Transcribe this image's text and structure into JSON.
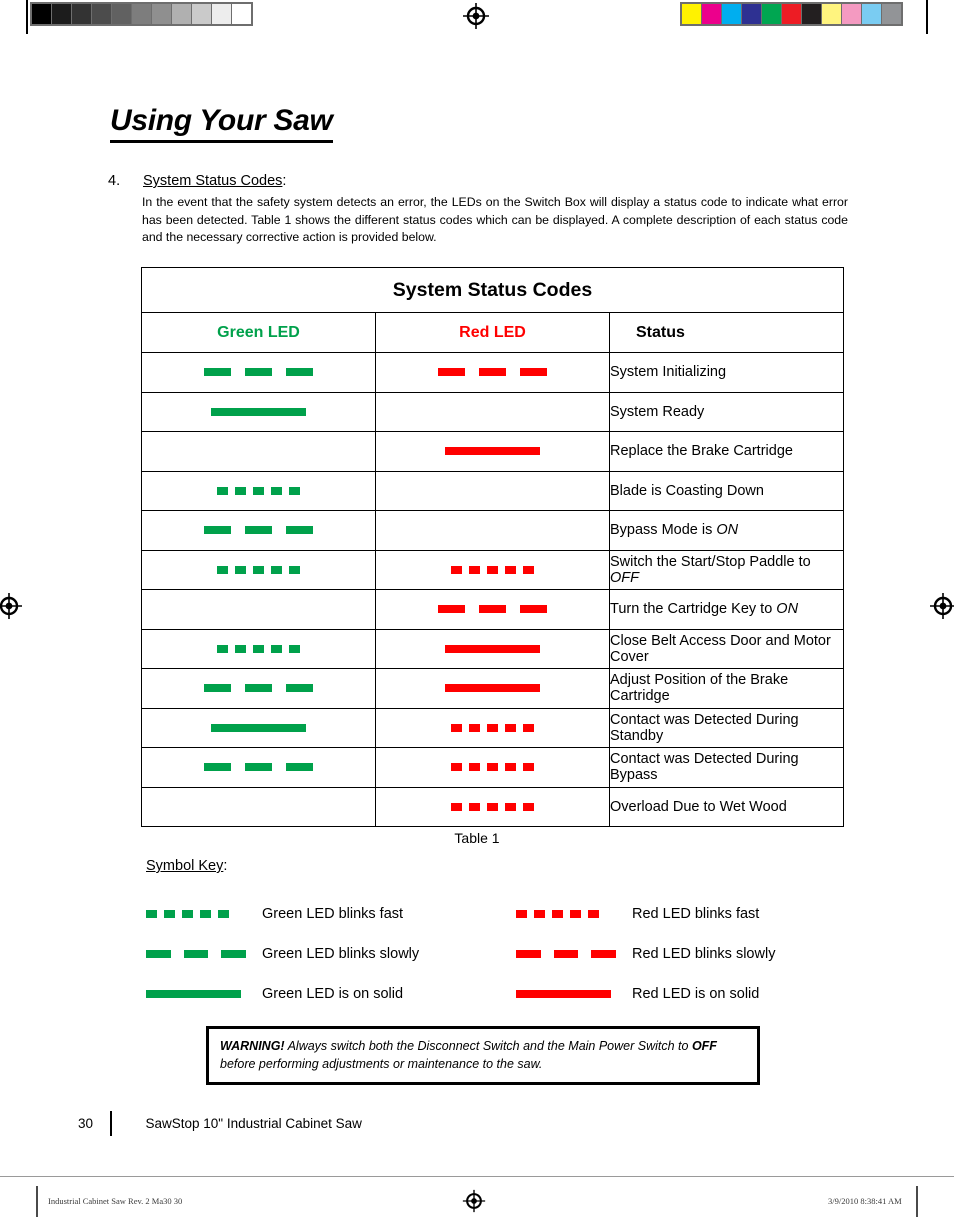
{
  "print_marks": {
    "grayscale_swatches": [
      "#000000",
      "#1c1c1c",
      "#333333",
      "#4c4c4c",
      "#616161",
      "#7d7d7d",
      "#8f8f8f",
      "#b0b0b0",
      "#cacaca",
      "#ededed",
      "#ffffff"
    ],
    "color_swatches": [
      "#fff200",
      "#ec008c",
      "#00aeef",
      "#2e3192",
      "#00a651",
      "#ed1c24",
      "#231f20",
      "#fff47f",
      "#f49ac1",
      "#7accf2",
      "#929497"
    ],
    "registration_icon": "registration-crosshair-icon"
  },
  "page": {
    "title": "Using Your Saw",
    "item": {
      "number": "4.",
      "heading": "System Status Codes",
      "heading_suffix": ":",
      "paragraph": "In the event that the safety system detects an error, the LEDs on the Switch Box will display a status code to indicate what error has been detected. Table 1 shows the different status codes which can be displayed. A complete description of each status code and the necessary corrective action is provided below."
    }
  },
  "table": {
    "title": "System Status Codes",
    "caption": "Table 1",
    "columns": [
      "Green LED",
      "Red LED",
      "Status"
    ],
    "column_colors": {
      "green": "#00a14b",
      "red": "#ff0000"
    },
    "rows": [
      {
        "green": "slow",
        "red": "slow",
        "status": "System Initializing",
        "status_italic": ""
      },
      {
        "green": "solid",
        "red": "off",
        "status": "System Ready",
        "status_italic": ""
      },
      {
        "green": "off",
        "red": "solid",
        "status": "Replace the Brake Cartridge",
        "status_italic": ""
      },
      {
        "green": "fast",
        "red": "off",
        "status": "Blade is Coasting Down",
        "status_italic": ""
      },
      {
        "green": "slow",
        "red": "off",
        "status": "Bypass Mode is ",
        "status_italic": "ON"
      },
      {
        "green": "fast",
        "red": "fast",
        "status": "Switch the Start/Stop Paddle to ",
        "status_italic": "OFF"
      },
      {
        "green": "off",
        "red": "slow",
        "status": "Turn the Cartridge Key to ",
        "status_italic": "ON"
      },
      {
        "green": "fast",
        "red": "solid",
        "status": "Close Belt Access Door and Motor Cover",
        "status_italic": ""
      },
      {
        "green": "slow",
        "red": "solid",
        "status": "Adjust Position of the Brake Cartridge",
        "status_italic": ""
      },
      {
        "green": "solid",
        "red": "fast",
        "status": "Contact was Detected During Standby",
        "status_italic": ""
      },
      {
        "green": "slow",
        "red": "fast",
        "status": "Contact was Detected During Bypass",
        "status_italic": ""
      },
      {
        "green": "off",
        "red": "fast",
        "status": "Overload Due to Wet Wood",
        "status_italic": ""
      }
    ]
  },
  "symbol_key": {
    "title": "Symbol Key",
    "title_suffix": ":",
    "entries": [
      {
        "color": "g",
        "pattern": "fast",
        "label": "Green LED blinks fast"
      },
      {
        "color": "r",
        "pattern": "fast",
        "label": "Red LED blinks fast"
      },
      {
        "color": "g",
        "pattern": "slow",
        "label": "Green LED blinks slowly"
      },
      {
        "color": "r",
        "pattern": "slow",
        "label": "Red LED blinks slowly"
      },
      {
        "color": "g",
        "pattern": "solid",
        "label": "Green LED is on solid"
      },
      {
        "color": "r",
        "pattern": "solid",
        "label": "Red LED is on solid"
      }
    ]
  },
  "warning": {
    "lead": "WARNING!",
    "text_1": " Always switch both the Disconnect Switch and the Main Power Switch to ",
    "emphasis": "OFF",
    "text_2": " before performing adjustments or maintenance to the saw."
  },
  "footer": {
    "page_number": "30",
    "product": "SawStop 10\" Industrial Cabinet Saw"
  },
  "print_footer": {
    "left": "Industrial Cabinet Saw Rev. 2 Ma30   30",
    "right": "3/9/2010   8:38:41 AM"
  }
}
